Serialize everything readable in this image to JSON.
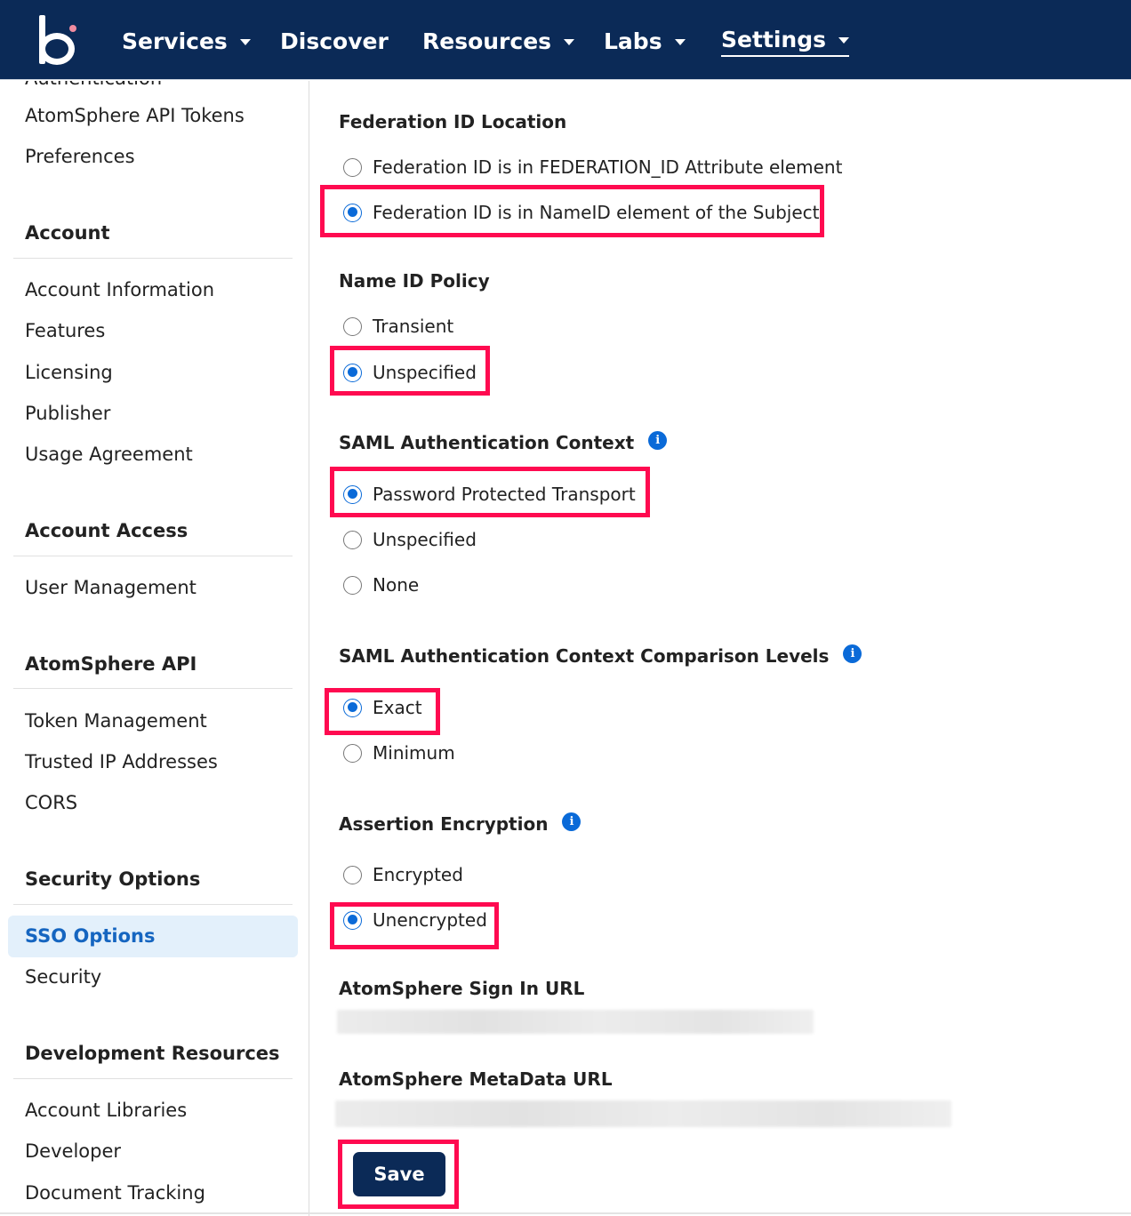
{
  "topnav": {
    "logo": "boomi-logo",
    "items": [
      {
        "label": "Services",
        "has_dropdown": true
      },
      {
        "label": "Discover",
        "has_dropdown": false
      },
      {
        "label": "Resources",
        "has_dropdown": true
      },
      {
        "label": "Labs",
        "has_dropdown": true
      },
      {
        "label": "Settings",
        "has_dropdown": true,
        "active": true
      }
    ]
  },
  "sidebar": {
    "clipped_item": "Authentication",
    "user_items": [
      "AtomSphere API Tokens",
      "Preferences"
    ],
    "sections": [
      {
        "title": "Account",
        "items": [
          "Account Information",
          "Features",
          "Licensing",
          "Publisher",
          "Usage Agreement"
        ]
      },
      {
        "title": "Account Access",
        "items": [
          "User Management"
        ]
      },
      {
        "title": "AtomSphere API",
        "items": [
          "Token Management",
          "Trusted IP Addresses",
          "CORS"
        ]
      },
      {
        "title": "Security Options",
        "items": [
          "SSO Options",
          "Security"
        ],
        "active": "SSO Options"
      },
      {
        "title": "Development Resources",
        "items": [
          "Account Libraries",
          "Developer",
          "Document Tracking"
        ]
      }
    ]
  },
  "form": {
    "federation_id_location": {
      "title": "Federation ID Location",
      "options": [
        "Federation ID is in FEDERATION_ID Attribute element",
        "Federation ID is in NameID element of the Subject"
      ],
      "selected": "Federation ID is in NameID element of the Subject"
    },
    "name_id_policy": {
      "title": "Name ID Policy",
      "options": [
        "Transient",
        "Unspecified"
      ],
      "selected": "Unspecified"
    },
    "saml_auth_context": {
      "title": "SAML Authentication Context",
      "options": [
        "Password Protected Transport",
        "Unspecified",
        "None"
      ],
      "selected": "Password Protected Transport"
    },
    "saml_comparison_levels": {
      "title": "SAML Authentication Context Comparison Levels",
      "options": [
        "Exact",
        "Minimum"
      ],
      "selected": "Exact"
    },
    "assertion_encryption": {
      "title": "Assertion Encryption",
      "options": [
        "Encrypted",
        "Unencrypted"
      ],
      "selected": "Unencrypted"
    },
    "sign_in_url": {
      "title": "AtomSphere Sign In URL",
      "value": "(redacted)"
    },
    "metadata_url": {
      "title": "AtomSphere MetaData URL",
      "value": "(redacted)"
    },
    "save_label": "Save"
  },
  "colors": {
    "nav_bg": "#0b2a57",
    "accent": "#0a6ad8",
    "highlight": "#ff0a50",
    "active_bg": "#e3f0fb"
  }
}
